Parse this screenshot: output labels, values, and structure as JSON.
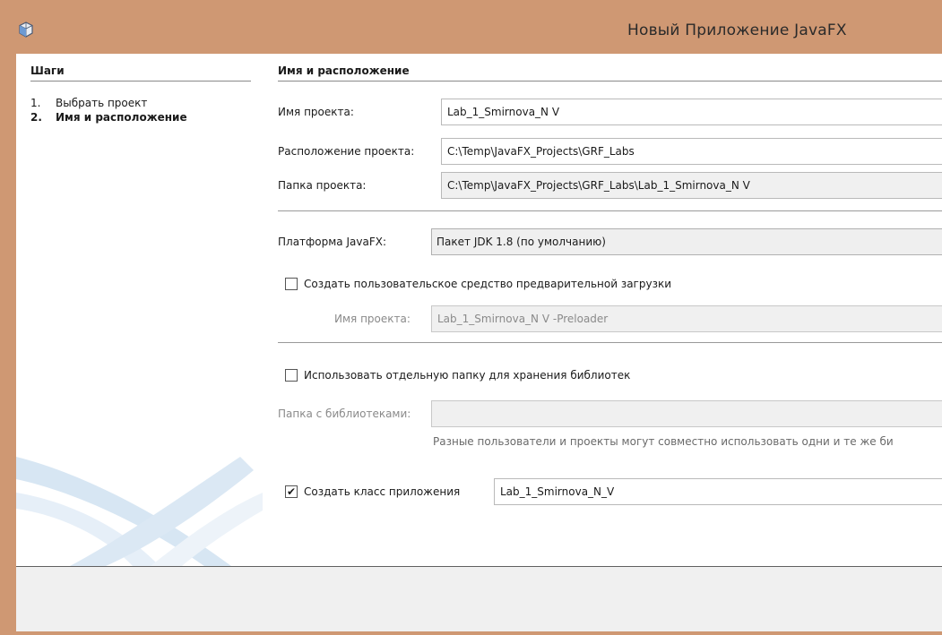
{
  "window": {
    "title": "Новый Приложение JavaFX",
    "icon": "java-cup-icon",
    "accent_color": "#cf9873"
  },
  "steps": {
    "title": "Шаги",
    "items": [
      {
        "num": "1.",
        "label": "Выбрать проект",
        "active": false
      },
      {
        "num": "2.",
        "label": "Имя и расположение",
        "active": true
      }
    ]
  },
  "main": {
    "section_title": "Имя и расположение",
    "project_name": {
      "label": "Имя проекта:",
      "value": "Lab_1_Smirnova_N V"
    },
    "project_location": {
      "label": "Расположение проекта:",
      "value": "C:\\Temp\\JavaFX_Projects\\GRF_Labs"
    },
    "project_folder": {
      "label": "Папка проекта:",
      "value": "C:\\Temp\\JavaFX_Projects\\GRF_Labs\\Lab_1_Smirnova_N V"
    },
    "platform": {
      "label": "Платформа JavaFX:",
      "selected": "Пакет JDK 1.8 (по умолчанию)"
    },
    "preloader": {
      "checkbox_label": "Создать пользовательское средство предварительной загрузки",
      "checked": false,
      "name_label": "Имя проекта:",
      "name_value": "Lab_1_Smirnova_N V -Preloader"
    },
    "libraries": {
      "checkbox_label": "Использовать отдельную папку для хранения библиотек",
      "checked": false,
      "folder_label": "Папка с библиотеками:",
      "folder_value": "",
      "hint": "Разные пользователи и проекты могут совместно использовать одни и те же би"
    },
    "app_class": {
      "checkbox_label": "Создать класс приложения",
      "checked": true,
      "check_mark": "✔",
      "value": "Lab_1_Smirnova_N_V"
    }
  }
}
